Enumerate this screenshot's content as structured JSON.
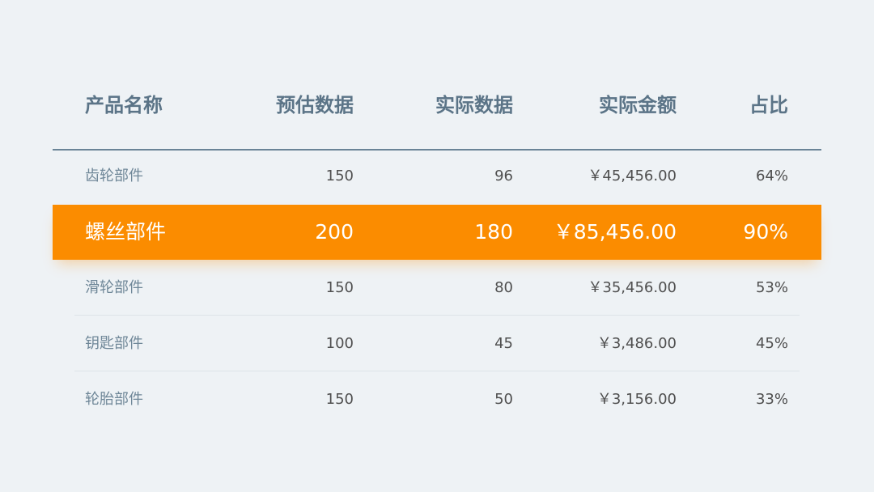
{
  "table": {
    "columns": [
      "产品名称",
      "预估数据",
      "实际数据",
      "实际金额",
      "占比"
    ],
    "rows": [
      [
        "齿轮部件",
        "150",
        "96",
        "￥45,456.00",
        "64%"
      ],
      [
        "螺丝部件",
        "200",
        "180",
        "￥85,456.00",
        "90%"
      ],
      [
        "滑轮部件",
        "150",
        "80",
        "￥35,456.00",
        "53%"
      ],
      [
        "钥匙部件",
        "100",
        "45",
        "￥3,486.00",
        "45%"
      ],
      [
        "轮胎部件",
        "150",
        "50",
        "￥3,156.00",
        "33%"
      ]
    ],
    "highlighted_row_index": 1
  },
  "colors": {
    "background": "#eef2f5",
    "header_text": "#5b7487",
    "highlight": "#fb8c00",
    "row_name_text": "#6f8798",
    "row_value_text": "#4f4f4f"
  }
}
